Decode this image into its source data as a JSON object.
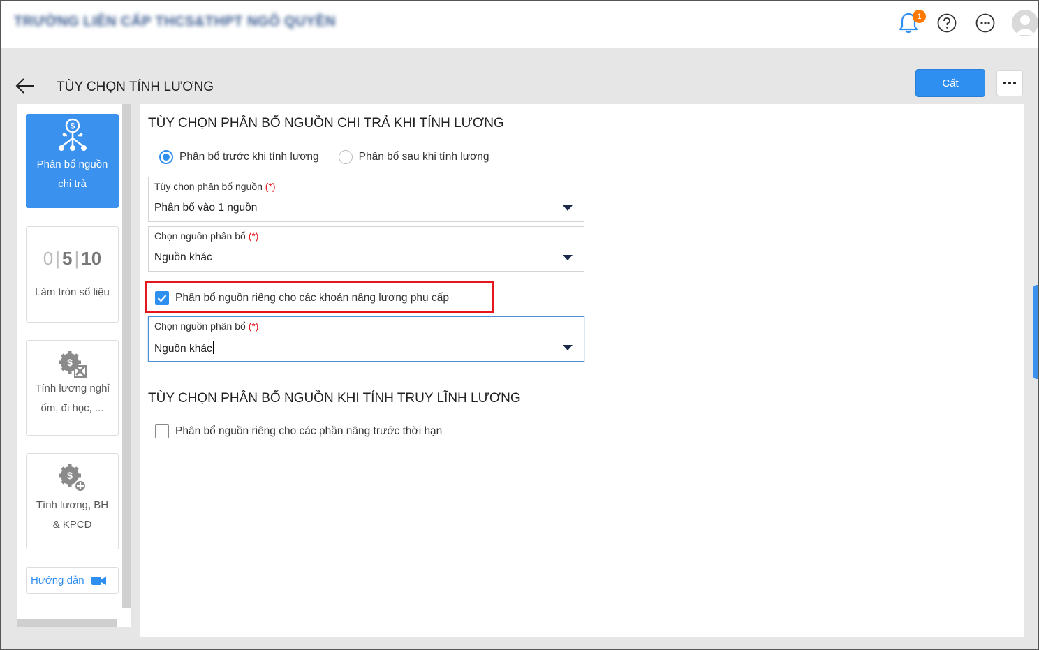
{
  "topbar": {
    "org_name": "TRƯỜNG LIÊN CẤP THCS&THPT NGÔ QUYỀN",
    "notification_count": "1",
    "icons": [
      "bell-icon",
      "help-icon",
      "more-icon",
      "avatar"
    ]
  },
  "header": {
    "title": "TÙY CHỌN TÍNH LƯƠNG",
    "save_label": "Cất"
  },
  "sidebar": {
    "items": [
      {
        "label": "Phân bổ nguồn chi trả",
        "icon": "money-distribution-icon",
        "active": true
      },
      {
        "label": "Làm tròn số liệu",
        "icon": "rounding-numbers-icon",
        "active": false
      },
      {
        "label": "Tính lương nghỉ ốm, đi học, ...",
        "icon": "salary-settings-icon",
        "active": false
      },
      {
        "label": "Tính lương, BH & KPCĐ",
        "icon": "salary-add-icon",
        "active": false
      }
    ],
    "round_icon_text": {
      "a": "0",
      "b": "5",
      "c": "10"
    },
    "guide_label": "Hướng dẫn"
  },
  "section1": {
    "title": "TÙY CHỌN PHÂN BỔ NGUỒN CHI TRẢ KHI TÍNH LƯƠNG",
    "radio_before": "Phân bổ trước khi tính lương",
    "radio_after": "Phân bổ sau khi tính lương",
    "selected": "before",
    "field1": {
      "label": "Tùy chọn phân bổ nguồn",
      "required": "(*)",
      "value": "Phân bổ vào 1 nguồn"
    },
    "field2": {
      "label": "Chọn nguồn phân bổ",
      "required": "(*)",
      "value": "Nguồn khác"
    },
    "checkbox_label": "Phân bổ nguồn riêng cho các khoản nâng lương phụ cấp",
    "checkbox_checked": true,
    "field3": {
      "label": "Chọn nguồn phân bổ",
      "required": "(*)",
      "value": "Nguồn khác"
    }
  },
  "section2": {
    "title": "TÙY CHỌN PHÂN BỔ NGUỒN KHI TÍNH TRUY LĨNH LƯƠNG",
    "checkbox_label": "Phân bổ nguồn riêng cho các phần nâng trước thời hạn",
    "checkbox_checked": false
  },
  "colors": {
    "accent": "#2f8ff0",
    "required": "#e5161d",
    "badge": "#ff7a00",
    "highlight": "#e5161d"
  }
}
